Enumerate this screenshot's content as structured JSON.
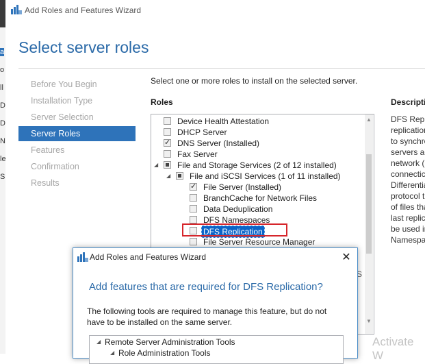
{
  "window": {
    "title": "Add Roles and Features Wizard"
  },
  "page": {
    "title": "Select server roles",
    "intro": "Select one or more roles to install on the selected server.",
    "roles_heading": "Roles",
    "description_heading": "Description"
  },
  "nav": [
    {
      "label": "Before You Begin",
      "active": false
    },
    {
      "label": "Installation Type",
      "active": false
    },
    {
      "label": "Server Selection",
      "active": false
    },
    {
      "label": "Server Roles",
      "active": true
    },
    {
      "label": "Features",
      "active": false
    },
    {
      "label": "Confirmation",
      "active": false
    },
    {
      "label": "Results",
      "active": false
    }
  ],
  "roles": [
    {
      "label": "Device Health Attestation",
      "state": "unchecked",
      "level": 0,
      "expander": ""
    },
    {
      "label": "DHCP Server",
      "state": "unchecked",
      "level": 0,
      "expander": ""
    },
    {
      "label": "DNS Server (Installed)",
      "state": "checked",
      "level": 0,
      "expander": ""
    },
    {
      "label": "Fax Server",
      "state": "unchecked",
      "level": 0,
      "expander": ""
    },
    {
      "label": "File and Storage Services (2 of 12 installed)",
      "state": "partial",
      "level": 0,
      "expander": "◢"
    },
    {
      "label": "File and iSCSI Services (1 of 11 installed)",
      "state": "partial",
      "level": 1,
      "expander": "◢"
    },
    {
      "label": "File Server (Installed)",
      "state": "checked",
      "level": 2,
      "expander": ""
    },
    {
      "label": "BranchCache for Network Files",
      "state": "unchecked",
      "level": 2,
      "expander": ""
    },
    {
      "label": "Data Deduplication",
      "state": "unchecked",
      "level": 2,
      "expander": ""
    },
    {
      "label": "DFS Namespaces",
      "state": "unchecked",
      "level": 2,
      "expander": ""
    },
    {
      "label": "DFS Replication",
      "state": "unchecked",
      "level": 2,
      "expander": "",
      "selected": true
    },
    {
      "label": "File Server Resource Manager",
      "state": "unchecked",
      "level": 2,
      "expander": ""
    }
  ],
  "description_lines": [
    "DFS Replic",
    "replication",
    "to synchro",
    "servers ac",
    "network (",
    "connectic",
    "Differentia",
    "protocol t",
    "of files tha",
    "last replic",
    "be used ir",
    "Namespa"
  ],
  "background_fragment": "S",
  "watermark": "Activate W",
  "left_strip_letters": [
    "a",
    "o",
    "ll",
    "D",
    "D",
    "N",
    "le",
    "S"
  ],
  "dialog": {
    "title": "Add Roles and Features Wizard",
    "close": "✕",
    "heading": "Add features that are required for DFS Replication?",
    "body": "The following tools are required to manage this feature, but do not have to be installed on the same server.",
    "tree": [
      {
        "label": "Remote Server Administration Tools",
        "level": 0,
        "expander": "◢"
      },
      {
        "label": "Role Administration Tools",
        "level": 1,
        "expander": "◢"
      }
    ]
  },
  "colors": {
    "accent": "#2e73ba",
    "title_blue": "#2b6aa8",
    "highlight": "#d6262b"
  }
}
